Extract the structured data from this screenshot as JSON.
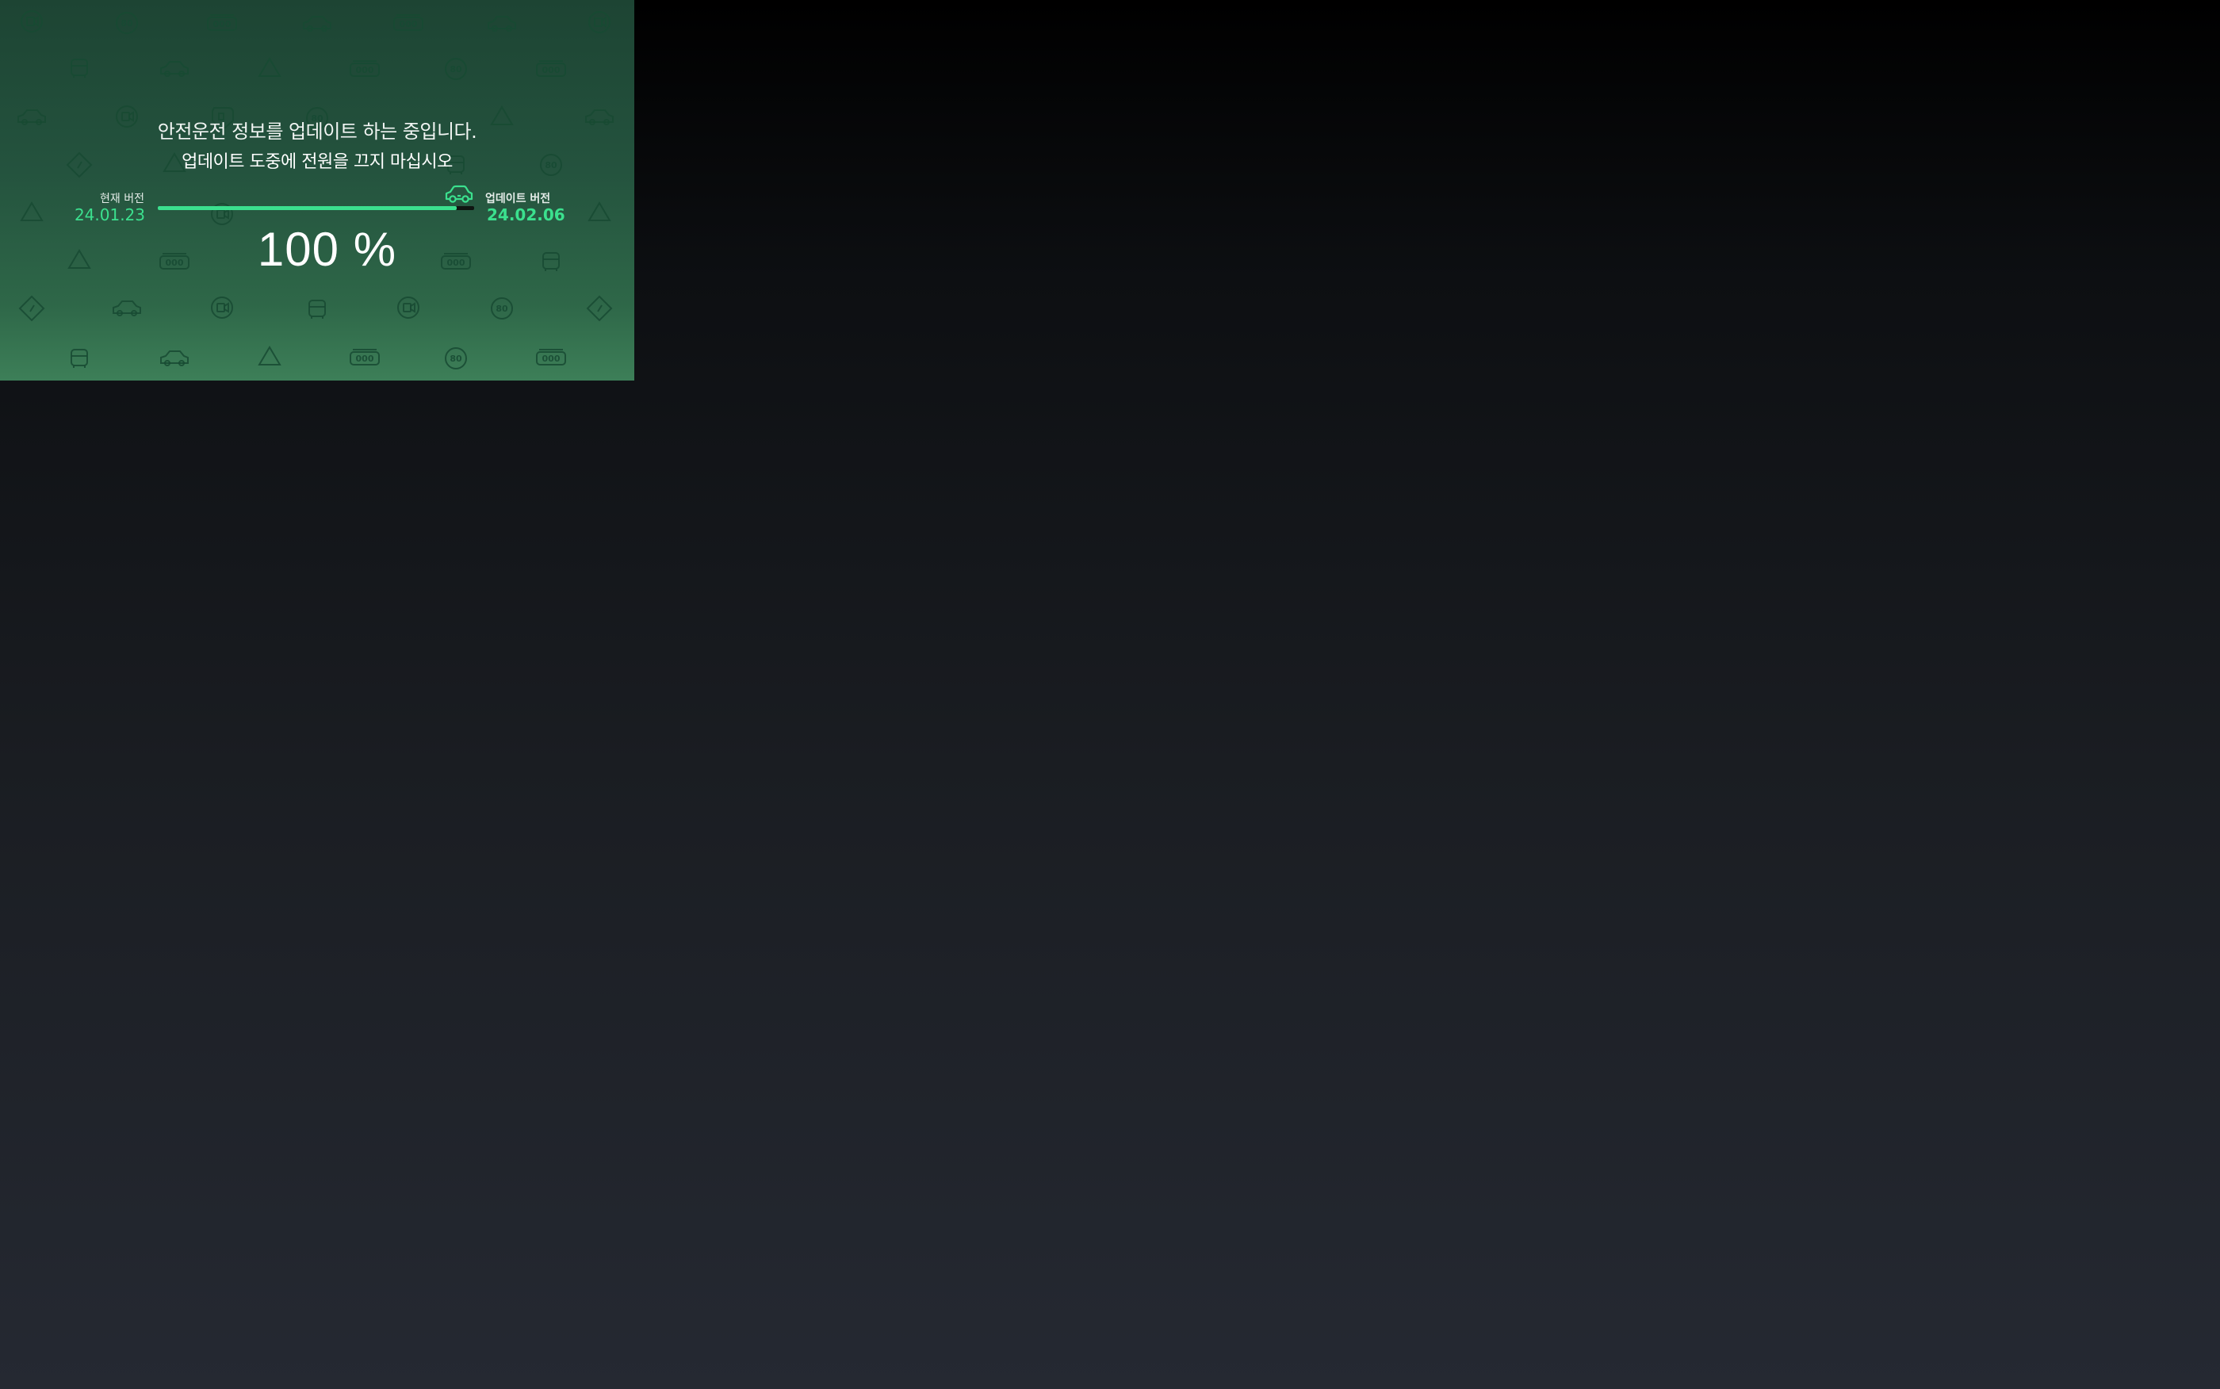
{
  "update_screen": {
    "title": "안전운전 정보를 업데이트 하는 중입니다.",
    "subtitle": "업데이트 도중에 전원을 끄지 마십시오",
    "current_version_label": "현재 버전",
    "current_version": "24.01.23",
    "update_version_label": "업데이트 버전",
    "update_version": "24.02.06",
    "progress_percent": 100,
    "progress_text": "100 %",
    "progress_icon": "car-icon"
  },
  "background_pattern_icons": [
    "camera-icon",
    "speed-limit-icon",
    "speed-bump-icon",
    "car-icon",
    "warning-triangle-icon",
    "bus-icon",
    "diamond-sign-icon",
    "average-speed-icon"
  ],
  "colors": {
    "accent": "#3be08e",
    "panel_top": "#1d4433",
    "panel_bottom": "#3d7f58",
    "outside_background": "#1a1d22"
  },
  "pattern_labels": {
    "speed": "80",
    "bump": "000"
  }
}
